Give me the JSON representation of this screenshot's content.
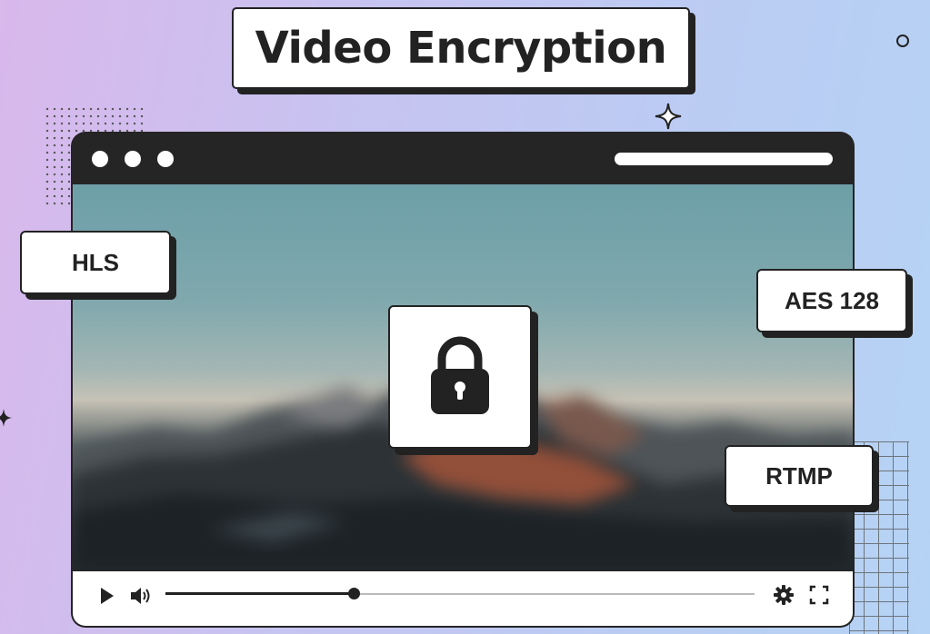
{
  "title": "Video Encryption",
  "tags": {
    "hls": "HLS",
    "aes": "AES 128",
    "rtmp": "RTMP"
  },
  "player": {
    "progress_fraction": 0.32,
    "icons": [
      "play-icon",
      "volume-icon",
      "settings-icon",
      "fullscreen-icon",
      "lock-icon"
    ]
  },
  "colors": {
    "frame": "#252525",
    "background_left": "#d9b8ec",
    "background_right": "#b5d3f4"
  }
}
